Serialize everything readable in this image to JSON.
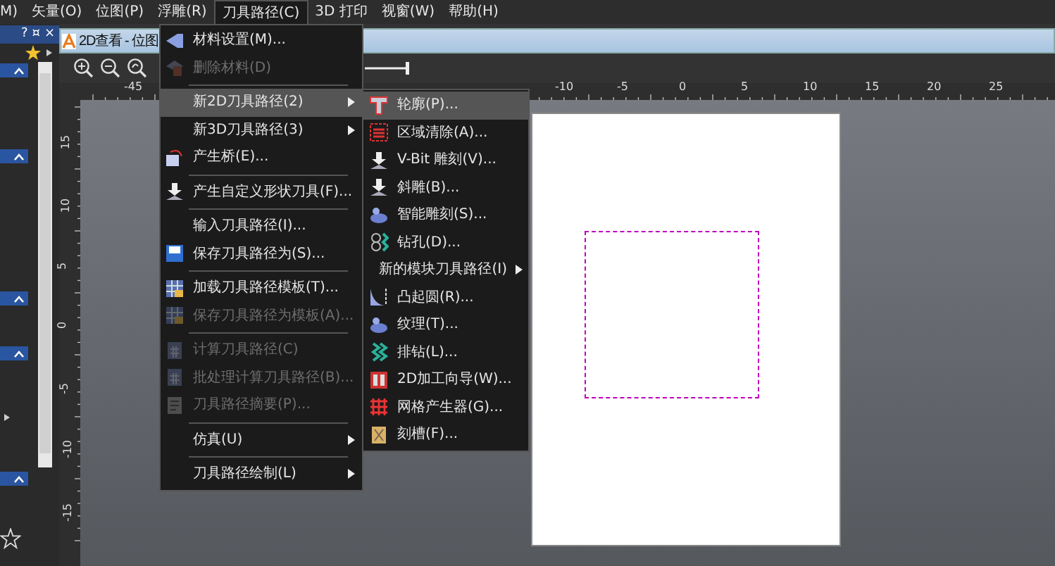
{
  "menubar": [
    {
      "label": "M)",
      "selected": false
    },
    {
      "label": "矢量(O)",
      "selected": false
    },
    {
      "label": "位图(P)",
      "selected": false
    },
    {
      "label": "浮雕(R)",
      "selected": false
    },
    {
      "label": "刀具路径(C)",
      "selected": true
    },
    {
      "label": "3D 打印",
      "selected": false
    },
    {
      "label": "视窗(W)",
      "selected": false
    },
    {
      "label": "帮助(H)",
      "selected": false
    }
  ],
  "left_panel": {
    "header_buttons": [
      "?",
      "¤",
      "×"
    ]
  },
  "viewer": {
    "title": "2D查看 - 位图"
  },
  "ruler": {
    "horizontal": [
      "-45",
      "-10",
      "-5",
      "0",
      "5",
      "10",
      "15",
      "20",
      "25"
    ],
    "vertical": [
      "15",
      "10",
      "5",
      "0",
      "-5",
      "-10",
      "-15"
    ]
  },
  "menu": [
    {
      "kind": "item",
      "label": "材料设置(M)...",
      "disabled": false,
      "selected": false
    },
    {
      "kind": "item",
      "label": "删除材料(D)",
      "disabled": true,
      "selected": false
    },
    {
      "kind": "separator"
    },
    {
      "kind": "submenu",
      "label": "新2D刀具路径(2)",
      "disabled": false,
      "selected": true
    },
    {
      "kind": "submenu",
      "label": "新3D刀具路径(3)",
      "disabled": false,
      "selected": false
    },
    {
      "kind": "item",
      "label": "产生桥(E)...",
      "disabled": false,
      "selected": false
    },
    {
      "kind": "separator"
    },
    {
      "kind": "item",
      "label": "产生自定义形状刀具(F)...",
      "disabled": false,
      "selected": false
    },
    {
      "kind": "separator"
    },
    {
      "kind": "item",
      "label": "输入刀具路径(I)...",
      "disabled": false,
      "selected": false
    },
    {
      "kind": "item",
      "label": "保存刀具路径为(S)...",
      "disabled": false,
      "selected": false
    },
    {
      "kind": "separator"
    },
    {
      "kind": "item",
      "label": "加载刀具路径模板(T)...",
      "disabled": false,
      "selected": false
    },
    {
      "kind": "item",
      "label": "保存刀具路径为模板(A)...",
      "disabled": true,
      "selected": false
    },
    {
      "kind": "separator"
    },
    {
      "kind": "item",
      "label": "计算刀具路径(C)",
      "disabled": true,
      "selected": false
    },
    {
      "kind": "item",
      "label": "批处理计算刀具路径(B)...",
      "disabled": true,
      "selected": false
    },
    {
      "kind": "item",
      "label": "刀具路径摘要(P)...",
      "disabled": true,
      "selected": false
    },
    {
      "kind": "separator"
    },
    {
      "kind": "submenu",
      "label": "仿真(U)",
      "disabled": false,
      "selected": false
    },
    {
      "kind": "separator"
    },
    {
      "kind": "submenu",
      "label": "刀具路径绘制(L)",
      "disabled": false,
      "selected": false
    }
  ],
  "submenu": [
    {
      "kind": "item",
      "label": "轮廓(P)...",
      "selected": true
    },
    {
      "kind": "item",
      "label": "区域清除(A)...",
      "selected": false
    },
    {
      "kind": "item",
      "label": "V-Bit 雕刻(V)...",
      "selected": false
    },
    {
      "kind": "item",
      "label": "斜雕(B)...",
      "selected": false
    },
    {
      "kind": "item",
      "label": "智能雕刻(S)...",
      "selected": false
    },
    {
      "kind": "item",
      "label": "钻孔(D)...",
      "selected": false
    },
    {
      "kind": "submenu",
      "label": "新的模块刀具路径(I)",
      "selected": false
    },
    {
      "kind": "item",
      "label": "凸起圆(R)...",
      "selected": false
    },
    {
      "kind": "item",
      "label": "纹理(T)...",
      "selected": false
    },
    {
      "kind": "item",
      "label": "排钻(L)...",
      "selected": false
    },
    {
      "kind": "item",
      "label": "2D加工向导(W)...",
      "selected": false
    },
    {
      "kind": "item",
      "label": "网格产生器(G)...",
      "selected": false
    },
    {
      "kind": "item",
      "label": "刻槽(F)...",
      "selected": false
    }
  ]
}
